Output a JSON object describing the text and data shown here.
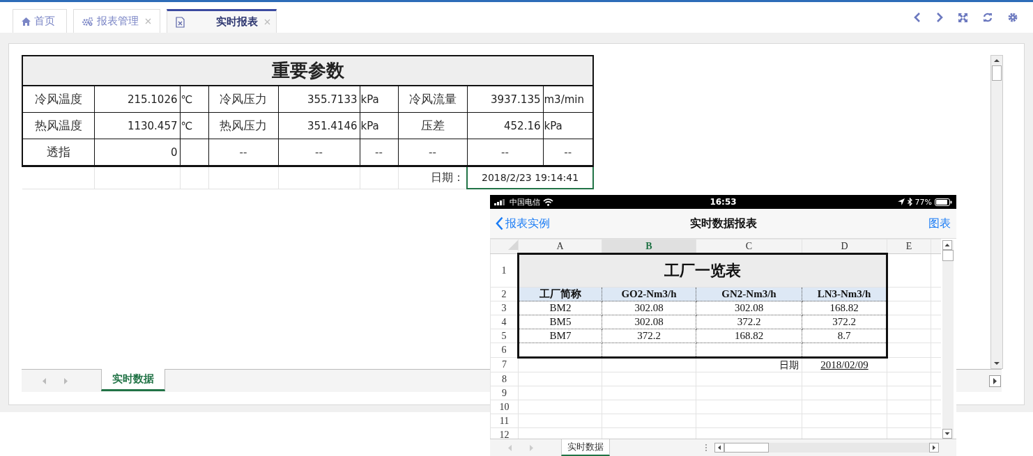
{
  "tabs": [
    {
      "label": "首页",
      "kind": "home",
      "closable": false,
      "selected": false
    },
    {
      "label": "报表管理",
      "kind": "gears",
      "closable": true,
      "selected": false
    },
    {
      "label": "实时报表",
      "kind": "excel",
      "closable": true,
      "selected": true
    }
  ],
  "report": {
    "title": "重要参数",
    "rows": [
      [
        {
          "text": "冷风温度",
          "kind": "label"
        },
        {
          "text": "215.1026",
          "kind": "value"
        },
        {
          "text": "℃",
          "kind": "unit"
        },
        {
          "text": "冷风压力",
          "kind": "label"
        },
        {
          "text": "355.7133",
          "kind": "value"
        },
        {
          "text": "kPa",
          "kind": "unit"
        },
        {
          "text": "冷风流量",
          "kind": "label"
        },
        {
          "text": "3937.135",
          "kind": "value"
        },
        {
          "text": "m3/min",
          "kind": "unit"
        }
      ],
      [
        {
          "text": "热风温度",
          "kind": "label"
        },
        {
          "text": "1130.457",
          "kind": "value"
        },
        {
          "text": "℃",
          "kind": "unit"
        },
        {
          "text": "热风压力",
          "kind": "label"
        },
        {
          "text": "351.4146",
          "kind": "value"
        },
        {
          "text": "kPa",
          "kind": "unit"
        },
        {
          "text": "压差",
          "kind": "label"
        },
        {
          "text": "452.16",
          "kind": "value"
        },
        {
          "text": "kPa",
          "kind": "unit"
        }
      ],
      [
        {
          "text": "透指",
          "kind": "label"
        },
        {
          "text": "0",
          "kind": "value"
        },
        {
          "kind": "blank"
        },
        {
          "text": "--",
          "kind": "dash"
        },
        {
          "text": "--",
          "kind": "dash"
        },
        {
          "text": "--",
          "kind": "dash"
        },
        {
          "text": "--",
          "kind": "dash"
        },
        {
          "text": "--",
          "kind": "dash"
        },
        {
          "text": "--",
          "kind": "dash"
        }
      ]
    ],
    "date_label": "日期：",
    "date_value": "2018/2/23 19:14:41"
  },
  "sheet_tabs": [
    {
      "label": "实时数据",
      "selected": true
    }
  ],
  "phone": {
    "status_bar": {
      "carrier": "中国电信",
      "time": "16:53",
      "battery": "77%"
    },
    "nav": {
      "back": "报表实例",
      "title": "实时数据报表",
      "action": "图表"
    },
    "columns": [
      {
        "label": "A",
        "selected": false
      },
      {
        "label": "B",
        "selected": true
      },
      {
        "label": "C",
        "selected": false
      },
      {
        "label": "D",
        "selected": false
      },
      {
        "label": "E",
        "selected": false
      }
    ],
    "row_numbers": [
      "1",
      "2",
      "3",
      "4",
      "5",
      "6",
      "7",
      "8",
      "9",
      "10",
      "11",
      "12"
    ],
    "sheet": {
      "title": "工厂一览表",
      "header": [
        "工厂简称",
        "GO2-Nm3/h",
        "GN2-Nm3/h",
        "LN3-Nm3/h"
      ],
      "rows": [
        [
          "BM2",
          "302.08",
          "302.08",
          "168.82"
        ],
        [
          "BM5",
          "302.08",
          "372.2",
          "372.2"
        ],
        [
          "BM7",
          "372.2",
          "168.82",
          "8.7"
        ]
      ],
      "date_label": "日期",
      "date_value": "2018/02/09"
    },
    "sheet_tabs": [
      {
        "label": "实时数据",
        "selected": true
      }
    ]
  }
}
